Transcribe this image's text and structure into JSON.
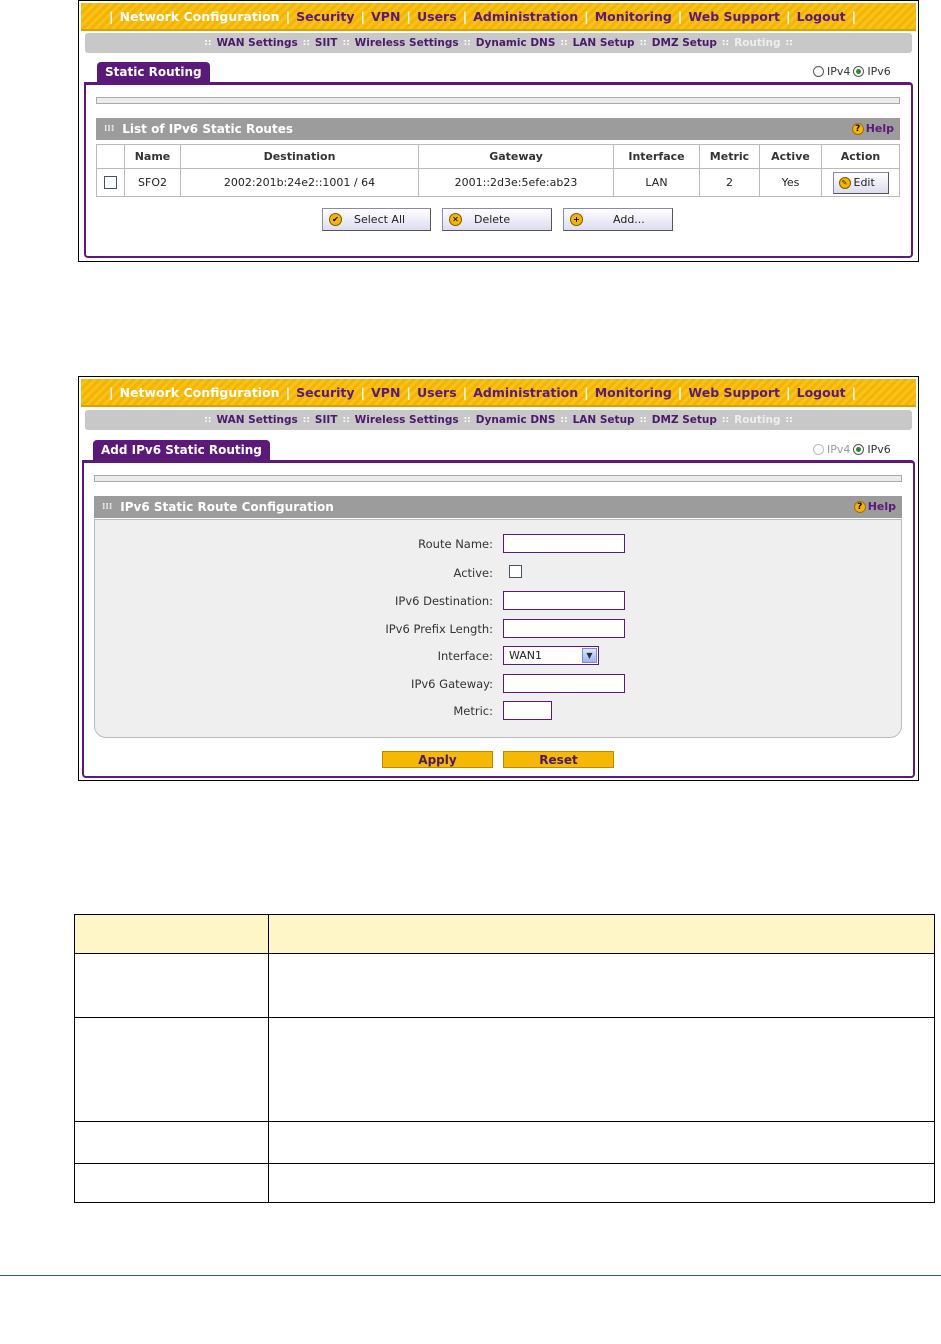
{
  "nav": [
    "Network Configuration",
    "Security",
    "VPN",
    "Users",
    "Administration",
    "Monitoring",
    "Web Support",
    "Logout"
  ],
  "subnav": [
    "WAN Settings",
    "SIIT",
    "Wireless Settings",
    "Dynamic DNS",
    "LAN Setup",
    "DMZ Setup",
    "Routing"
  ],
  "ip_versions": [
    "IPv4",
    "IPv6"
  ],
  "screen1": {
    "tab_title": "Static Routing",
    "section_title": "List of IPv6 Static Routes",
    "help_label": "Help",
    "columns": [
      "Name",
      "Destination",
      "Gateway",
      "Interface",
      "Metric",
      "Active",
      "Action"
    ],
    "row": {
      "name": "SFO2",
      "destination": "2002:201b:24e2::1001 / 64",
      "gateway": "2001::2d3e:5efe:ab23",
      "interface": "LAN",
      "metric": "2",
      "active": "Yes",
      "action": "Edit"
    },
    "buttons": {
      "select_all": "Select All",
      "delete": "Delete",
      "add": "Add..."
    }
  },
  "screen2": {
    "tab_title": "Add IPv6 Static Routing",
    "section_title": "IPv6 Static Route Configuration",
    "help_label": "Help",
    "fields": {
      "route_name": "Route Name:",
      "active": "Active:",
      "ipv6_destination": "IPv6 Destination:",
      "ipv6_prefix_length": "IPv6 Prefix Length:",
      "interface": "Interface:",
      "interface_value": "WAN1",
      "ipv6_gateway": "IPv6 Gateway:",
      "metric": "Metric:"
    },
    "buttons": {
      "apply": "Apply",
      "reset": "Reset"
    }
  }
}
